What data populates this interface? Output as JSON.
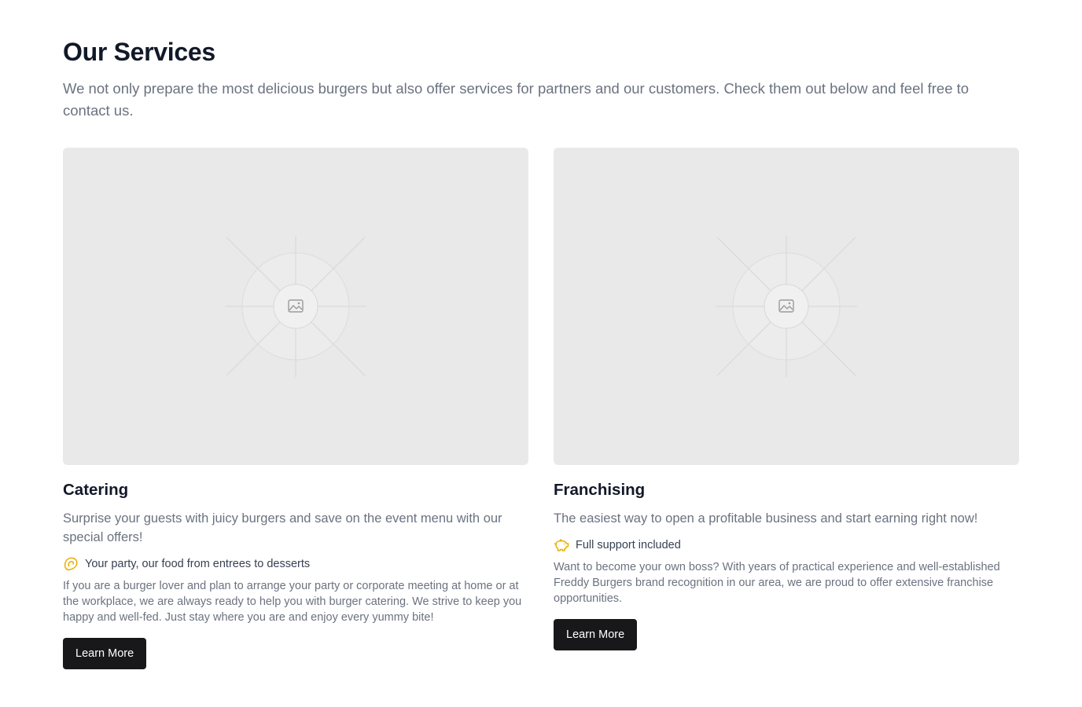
{
  "section": {
    "title": "Our Services",
    "lead": "We not only prepare the most delicious burgers but also offer services for partners and our customers. Check them out below and feel free to contact us."
  },
  "cards": [
    {
      "title": "Catering",
      "description": "Surprise your guests with juicy burgers and save on the event menu with our special offers!",
      "feature_icon": "cookie-icon",
      "feature_text": "Your party, our food from entrees to desserts",
      "body": "If you are a burger lover and plan to arrange your party or corporate meeting at home or at the workplace, we are always ready to help you with burger catering. We strive to keep you happy and well-fed. Just stay where you are and enjoy every yummy bite!",
      "button_label": "Learn More",
      "image_icon": "image-placeholder-icon"
    },
    {
      "title": "Franchising",
      "description": "The easiest way to open a profitable business and start earning right now!",
      "feature_icon": "piggy-bank-icon",
      "feature_text": "Full support included",
      "body": "Want to become your own boss? With years of practical experience and well-established Freddy Burgers brand recognition in our area, we are proud to offer extensive franchise opportunities.",
      "button_label": "Learn More",
      "image_icon": "image-placeholder-icon"
    }
  ],
  "colors": {
    "accent_icon": "#eab308",
    "button_bg": "#18181b",
    "placeholder_bg": "#e9e9e9"
  }
}
